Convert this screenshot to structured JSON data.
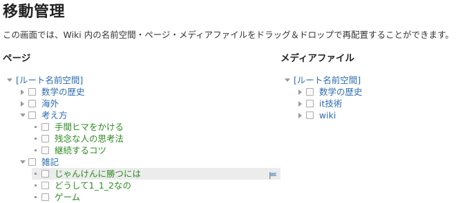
{
  "page_title": "移動管理",
  "description": "この画面では、Wiki 内の名前空間・ページ・メディアファイルをドラッグ＆ドロップで再配置することができます。",
  "pages_panel": {
    "heading": "ページ",
    "root_label": "[ルート名前空間]",
    "items": [
      {
        "label": "数学の歴史",
        "kind": "namespace",
        "state": "collapsed"
      },
      {
        "label": "海外",
        "kind": "namespace",
        "state": "collapsed"
      },
      {
        "label": "考え方",
        "kind": "namespace",
        "state": "expanded"
      },
      {
        "label": "手間ヒマをかける",
        "kind": "page"
      },
      {
        "label": "残念な人の思考法",
        "kind": "page"
      },
      {
        "label": "継続するコツ",
        "kind": "page"
      },
      {
        "label": "雑記",
        "kind": "namespace",
        "state": "expanded"
      },
      {
        "label": "じゃんけんに勝つには",
        "kind": "page",
        "highlighted": true
      },
      {
        "label": "どうして1_1_2なの",
        "kind": "page"
      },
      {
        "label": "ゲーム",
        "kind": "page"
      }
    ]
  },
  "media_panel": {
    "heading": "メディアファイル",
    "root_label": "[ルート名前空間]",
    "items": [
      {
        "label": "数学の歴史",
        "kind": "namespace",
        "state": "collapsed"
      },
      {
        "label": "it技術",
        "kind": "namespace",
        "state": "collapsed"
      },
      {
        "label": "wiki",
        "kind": "namespace",
        "state": "collapsed"
      }
    ]
  },
  "icons": {
    "expanded": "triangle-down-icon",
    "collapsed": "triangle-right-icon",
    "leaf": "bullet-icon",
    "rename": "flag-icon"
  },
  "colors": {
    "namespace_link": "#2b6cb0",
    "page_link": "#2e8b22",
    "highlight_row": "#ececec"
  }
}
